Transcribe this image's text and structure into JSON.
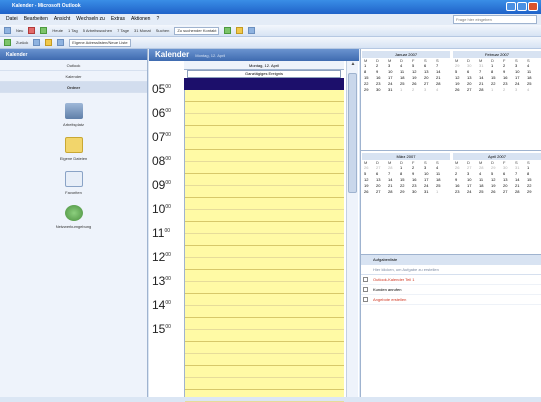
{
  "window": {
    "title": "Kalender - Microsoft Outlook",
    "accent": "#3f6bb0"
  },
  "menu": [
    "Datei",
    "Bearbeiten",
    "Ansicht",
    "Wechseln zu",
    "Extras",
    "Aktionen",
    "?"
  ],
  "help_box": "Frage hier eingeben",
  "toolbar1": {
    "new_label": "Neu",
    "today_label": "Heute",
    "day_label": "1 Tag",
    "workweek_label": "5 Arbeitswochen",
    "week_label": "7 Tage",
    "month_label": "31 Monat",
    "find_label": "Suchen",
    "contact_search": "Zu suchender Kontakt"
  },
  "toolbar2": {
    "back_label": "Zurück",
    "path_value": "Eigene Adresslisten/Neue Liste"
  },
  "nav": {
    "header": "Kalender",
    "links": [
      "Outlook",
      "Kalender",
      "Ordner"
    ],
    "shortcuts": [
      {
        "label": "Arbeitsplatz",
        "icon": "computer-icon"
      },
      {
        "label": "Eigene Dateien",
        "icon": "folder-icon"
      },
      {
        "label": "Favoriten",
        "icon": "favorites-icon"
      },
      {
        "label": "Netzwerkumgebung",
        "icon": "network-icon"
      }
    ]
  },
  "main": {
    "title": "Kalender",
    "subtitle": "Montag, 12. April",
    "day_header": "Montag, 12. April",
    "allday_box": "Ganztägiges Ereignis",
    "hours": [
      {
        "h": "05",
        "m": "00"
      },
      {
        "h": "06",
        "m": "00"
      },
      {
        "h": "07",
        "m": "00"
      },
      {
        "h": "08",
        "m": "00"
      },
      {
        "h": "09",
        "m": "00"
      },
      {
        "h": "10",
        "m": "00"
      },
      {
        "h": "11",
        "m": "00"
      },
      {
        "h": "12",
        "m": "00"
      },
      {
        "h": "13",
        "m": "00"
      },
      {
        "h": "14",
        "m": "00"
      },
      {
        "h": "15",
        "m": "00"
      }
    ]
  },
  "calendars": [
    {
      "title": "Januar 2007",
      "days": [
        "M",
        "D",
        "M",
        "D",
        "F",
        "S",
        "S"
      ],
      "rows": [
        [
          "1",
          "2",
          "3",
          "4",
          "5",
          "6",
          "7"
        ],
        [
          "8",
          "9",
          "10",
          "11",
          "12",
          "13",
          "14"
        ],
        [
          "15",
          "16",
          "17",
          "18",
          "19",
          "20",
          "21"
        ],
        [
          "22",
          "23",
          "24",
          "25",
          "26",
          "27",
          "28"
        ],
        [
          "29",
          "30",
          "31",
          "1",
          "2",
          "3",
          "4"
        ]
      ]
    },
    {
      "title": "Februar 2007",
      "days": [
        "M",
        "D",
        "M",
        "D",
        "F",
        "S",
        "S"
      ],
      "rows": [
        [
          "29",
          "30",
          "31",
          "1",
          "2",
          "3",
          "4"
        ],
        [
          "5",
          "6",
          "7",
          "8",
          "9",
          "10",
          "11"
        ],
        [
          "12",
          "13",
          "14",
          "15",
          "16",
          "17",
          "18"
        ],
        [
          "19",
          "20",
          "21",
          "22",
          "23",
          "24",
          "25"
        ],
        [
          "26",
          "27",
          "28",
          "1",
          "2",
          "3",
          "4"
        ]
      ]
    },
    {
      "title": "März 2007",
      "days": [
        "M",
        "D",
        "M",
        "D",
        "F",
        "S",
        "S"
      ],
      "rows": [
        [
          "26",
          "27",
          "28",
          "1",
          "2",
          "3",
          "4"
        ],
        [
          "5",
          "6",
          "7",
          "8",
          "9",
          "10",
          "11"
        ],
        [
          "12",
          "13",
          "14",
          "15",
          "16",
          "17",
          "18"
        ],
        [
          "19",
          "20",
          "21",
          "22",
          "23",
          "24",
          "25"
        ],
        [
          "26",
          "27",
          "28",
          "29",
          "30",
          "31",
          "1"
        ]
      ]
    },
    {
      "title": "April 2007",
      "days": [
        "M",
        "D",
        "M",
        "D",
        "F",
        "S",
        "S"
      ],
      "rows": [
        [
          "26",
          "27",
          "28",
          "29",
          "30",
          "31",
          "1"
        ],
        [
          "2",
          "3",
          "4",
          "5",
          "6",
          "7",
          "8"
        ],
        [
          "9",
          "10",
          "11",
          "12",
          "13",
          "14",
          "15"
        ],
        [
          "16",
          "17",
          "18",
          "19",
          "20",
          "21",
          "22"
        ],
        [
          "23",
          "24",
          "25",
          "26",
          "27",
          "28",
          "29"
        ]
      ]
    }
  ],
  "tasks": {
    "header": "Aufgabenliste",
    "input_placeholder": "Hier klicken, um Aufgabe zu erstellen",
    "items": [
      {
        "label": "Outlook-Kalender Teil 1",
        "overdue": true
      },
      {
        "label": "Kunden anrufen",
        "overdue": false
      },
      {
        "label": "Angebote erstellen",
        "overdue": true
      }
    ]
  }
}
